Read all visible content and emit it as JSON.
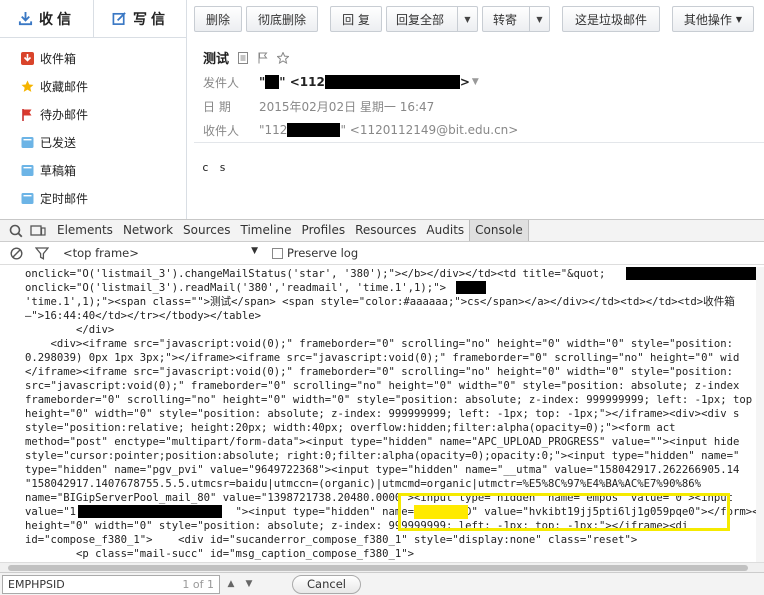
{
  "sidebar": {
    "receive_label": "收信",
    "write_label": "写信",
    "folders": [
      {
        "label": "收件箱",
        "icon": "inbox-icon"
      },
      {
        "label": "收藏邮件",
        "icon": "star-icon"
      },
      {
        "label": "待办邮件",
        "icon": "flag-icon"
      },
      {
        "label": "已发送",
        "icon": "folder-icon"
      },
      {
        "label": "草稿箱",
        "icon": "folder-icon"
      },
      {
        "label": "定时邮件",
        "icon": "folder-icon"
      }
    ]
  },
  "toolbar": {
    "delete": "删除",
    "permanent_delete": "彻底删除",
    "reply": "回 复",
    "reply_all": "回复全部",
    "forward": "转寄",
    "spam": "这是垃圾邮件",
    "more": "其他操作"
  },
  "message": {
    "subject": "测试",
    "from_label": "发件人",
    "from_value_prefix": "\"",
    "from_value_mid": "\" <112",
    "from_value_suffix": ">",
    "date_label": "日  期",
    "date_value": "2015年02月02日 星期一 16:47",
    "to_label": "收件人",
    "to_value_prefix": "\"112",
    "to_value_suffix": "\" <1120112149@bit.edu.cn>",
    "body": "c s"
  },
  "devtools": {
    "tabs": [
      "Elements",
      "Network",
      "Sources",
      "Timeline",
      "Profiles",
      "Resources",
      "Audits",
      "Console"
    ],
    "active_tab": "Console",
    "frame_select": "<top frame>",
    "preserve_log": "Preserve log",
    "console_lines": [
      "onclick=\"O('listmail_3').changeMailStatus('star', '380');\"></b></div></td><td title=\"&quot;",
      "onclick=\"O('listmail_3').readMail('380','readmail', 'time.1',1);\">",
      "'time.1',1);\"><span class=\"\">测试</span> <span style=\"color:#aaaaaa;\">cs</span></a></div></td><td></td><td>收件箱",
      "—\">16:44:40</td></tr></tbody></table>",
      "        </div>",
      "    <div><iframe src=\"javascript:void(0);\" frameborder=\"0\" scrolling=\"no\" height=\"0\" width=\"0\" style=\"position:",
      "0.298039) 0px 1px 3px;\"></iframe><iframe src=\"javascript:void(0);\" frameborder=\"0\" scrolling=\"no\" height=\"0\" wid",
      "</iframe><iframe src=\"javascript:void(0);\" frameborder=\"0\" scrolling=\"no\" height=\"0\" width=\"0\" style=\"position:",
      "src=\"javascript:void(0);\" frameborder=\"0\" scrolling=\"no\" height=\"0\" width=\"0\" style=\"position: absolute; z-index",
      "frameborder=\"0\" scrolling=\"no\" height=\"0\" width=\"0\" style=\"position: absolute; z-index: 999999999; left: -1px; top",
      "height=\"0\" width=\"0\" style=\"position: absolute; z-index: 999999999; left: -1px; top: -1px;\"></iframe><div><div s",
      "style=\"position:relative; height:20px; width:40px; overflow:hidden;filter:alpha(opacity=0);\"><form act",
      "method=\"post\" enctype=\"multipart/form-data\"><input type=\"hidden\" name=\"APC_UPLOAD_PROGRESS\" value=\"\"><input hide",
      "style=\"cursor:pointer;position:absolute; right:0;filter:alpha(opacity=0);opacity:0;\"><input type=\"hidden\" name=\"",
      "type=\"hidden\" name=\"pgv_pvi\" value=\"9649722368\"><input type=\"hidden\" name=\"__utma\" value=\"158042917.262266905.14",
      "\"158042917.1407678755.5.5.utmcsr=baidu|utmccn=(organic)|utmcmd=organic|utmctr=%E5%8C%97%E4%BA%AC%E7%90%86%",
      "name=\"BIGipServerPool_mail_80\" value=\"1398721738.20480.0000\"><input type=\"hidden\" name=\"empos\" value=\"0\"><input",
      "value=\"1                         \"><input type=\"hidden\" name=\"EMPHPSID\" value=\"hvkibt19jj5pti6lj1g059pqe0\"></form><",
      "height=\"0\" width=\"0\" style=\"position: absolute; z-index: 999999999; left: -1px; top: -1px;\"></iframe><di",
      "id=\"compose_f380_1\">    <div id=\"sucanderror_compose_f380_1\" style=\"display:none\" class=\"reset\">",
      "        <p class=\"mail-succ\" id=\"msg_caption_compose_f380_1\">"
    ],
    "highlight_word": "EMPHPSID"
  },
  "findbar": {
    "query": "EMPHPSID",
    "count": "1 of 1",
    "cancel": "Cancel"
  },
  "colors": {
    "highlight_box": "#f5ea00",
    "highlight_word": "#ffea00"
  }
}
